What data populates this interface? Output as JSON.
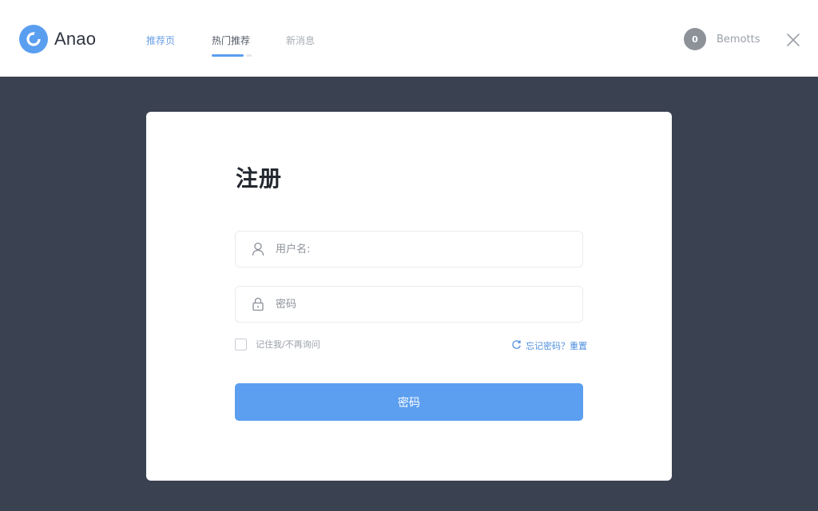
{
  "header": {
    "logo_text": "Anao",
    "tabs": [
      {
        "label": "推荐页"
      },
      {
        "label": "热门推荐"
      },
      {
        "label": "新消息"
      }
    ],
    "username": "Bemotts",
    "avatar_initial": "0"
  },
  "form": {
    "title": "注册",
    "username_placeholder": "用户名:",
    "password_placeholder": "密码",
    "remember_label": "记住我/不再询问",
    "forgot_label": "忘记密码？重置",
    "submit_label": "密码"
  },
  "colors": {
    "accent": "#5c9ff0",
    "backdrop": "#3a4150",
    "link": "#4f8fdf"
  },
  "icons": {
    "logo": "logo-mark-icon",
    "close": "close-icon",
    "user": "user-icon",
    "lock": "lock-icon",
    "refresh": "refresh-icon"
  }
}
